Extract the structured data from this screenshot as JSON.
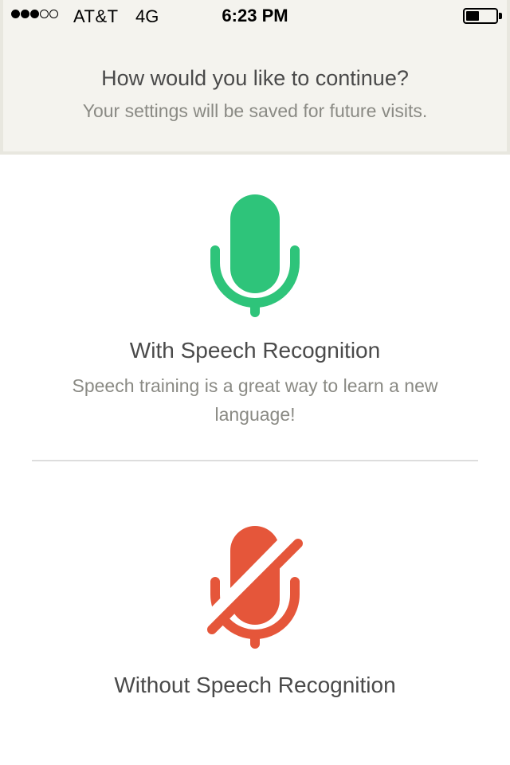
{
  "status_bar": {
    "signal_filled": 3,
    "signal_total": 5,
    "carrier": "AT&T",
    "network": "4G",
    "time": "6:23 PM",
    "battery_level": 0.45
  },
  "header": {
    "title": "How would you like to continue?",
    "subtitle": "Your settings will be saved for future visits."
  },
  "options": [
    {
      "title": "With Speech Recognition",
      "description": "Speech training is a great way to learn a new language!",
      "icon": "microphone-icon",
      "color": "#2ec47a"
    },
    {
      "title": "Without Speech Recognition",
      "icon": "microphone-off-icon",
      "color": "#e5563a"
    }
  ],
  "colors": {
    "header_bg": "#f4f3ee",
    "text_dark": "#4a4a4a",
    "text_muted": "#8a8a84",
    "divider": "#dddddd"
  }
}
